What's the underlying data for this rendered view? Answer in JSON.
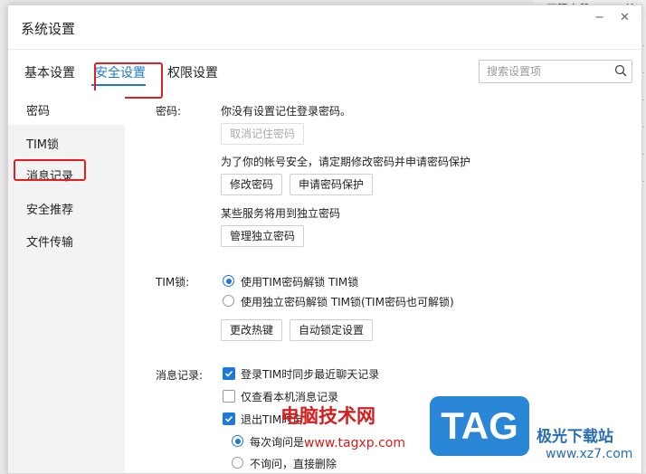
{
  "background_window": {
    "text1": "不限字段",
    "text2": "关"
  },
  "dialog": {
    "title": "系统设置",
    "controls": {
      "minimize": "−",
      "close": "✕"
    },
    "tabs": [
      "基本设置",
      "安全设置",
      "权限设置"
    ],
    "active_tab": "安全设置",
    "search": {
      "placeholder": "搜索设置项"
    },
    "sidebar": [
      "密码",
      "TIM锁",
      "消息记录",
      "安全推荐",
      "文件传输"
    ],
    "sidebar_selected": "密码",
    "password": {
      "label": "密码:",
      "no_saved": "你没有设置记住登录密码。",
      "cancel_remember": "取消记住密码",
      "advice": "为了你的帐号安全，请定期修改密码并申请密码保护",
      "change_pw": "修改密码",
      "apply_protect": "申请密码保护",
      "independent_desc": "某些服务将用到独立密码",
      "manage_independent": "管理独立密码"
    },
    "timlock": {
      "label": "TIM锁:",
      "option1": "使用TIM密码解锁 TIM锁",
      "option2": "使用独立密码解锁 TIM锁(TIM密码也可解锁)",
      "change_hotkey": "更改热键",
      "auto_lock": "自动锁定设置"
    },
    "messages": {
      "label": "消息记录:",
      "sync_recent": "登录TIM时同步最近聊天记录",
      "local_only": "仅查看本机消息记录",
      "exit_delete": "退出TIM时自",
      "ask_each": "每次询问是",
      "no_ask": "不询问，直接删除"
    }
  },
  "watermark": {
    "tag": "TAG",
    "site_cn": "电脑技术网",
    "url": "www.tagxp.com",
    "brand": "极光下载站",
    "brand_url": "www.xz7.com"
  },
  "colors": {
    "accent": "#1e78d6",
    "highlight_box": "#e02020"
  }
}
